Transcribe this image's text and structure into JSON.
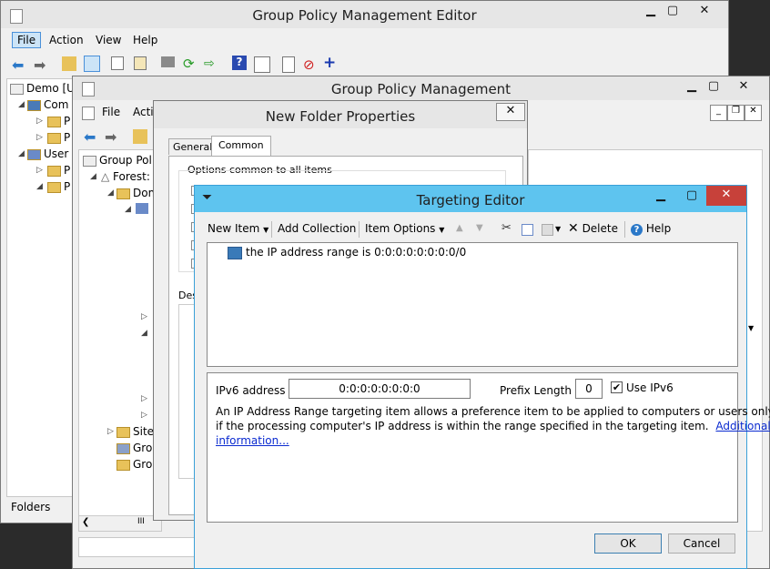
{
  "gpme": {
    "title": "Group Policy Management Editor",
    "menu": [
      "File",
      "Action",
      "View",
      "Help"
    ],
    "tree": [
      "Demo [U",
      "Com",
      "P",
      "P",
      "User",
      "P",
      "P"
    ],
    "status": "Folders"
  },
  "gpm": {
    "title": "Group Policy Management",
    "menu": [
      "File",
      "Actio"
    ],
    "tree": [
      "Group Poli",
      "Forest:",
      "Dom",
      "Site",
      "Gro",
      "Gro"
    ],
    "scroll_glyph": "III"
  },
  "nfp": {
    "title": "New Folder Properties",
    "tabs": [
      "General",
      "Common"
    ],
    "group_label": "Options common to all items",
    "desc_label": "Des"
  },
  "te": {
    "title": "Targeting Editor",
    "toolbar": {
      "new_item": "New Item",
      "add_collection": "Add Collection",
      "item_options": "Item Options",
      "delete": "Delete",
      "help": "Help"
    },
    "item": "the IP address range is 0:0:0:0:0:0:0:0/0",
    "ipv6_label": "IPv6 address",
    "ipv6_value": "0:0:0:0:0:0:0:0",
    "prefix_label": "Prefix Length",
    "prefix_value": "0",
    "use_ipv6": "Use IPv6",
    "help_line1": "An IP Address Range targeting item allows a preference item to be applied to computers or users only",
    "help_line2": "if the processing computer's IP address is within the range specified in the targeting item.",
    "link_part1": "Additional",
    "link_part2": "information...",
    "ok": "OK",
    "cancel": "Cancel"
  }
}
